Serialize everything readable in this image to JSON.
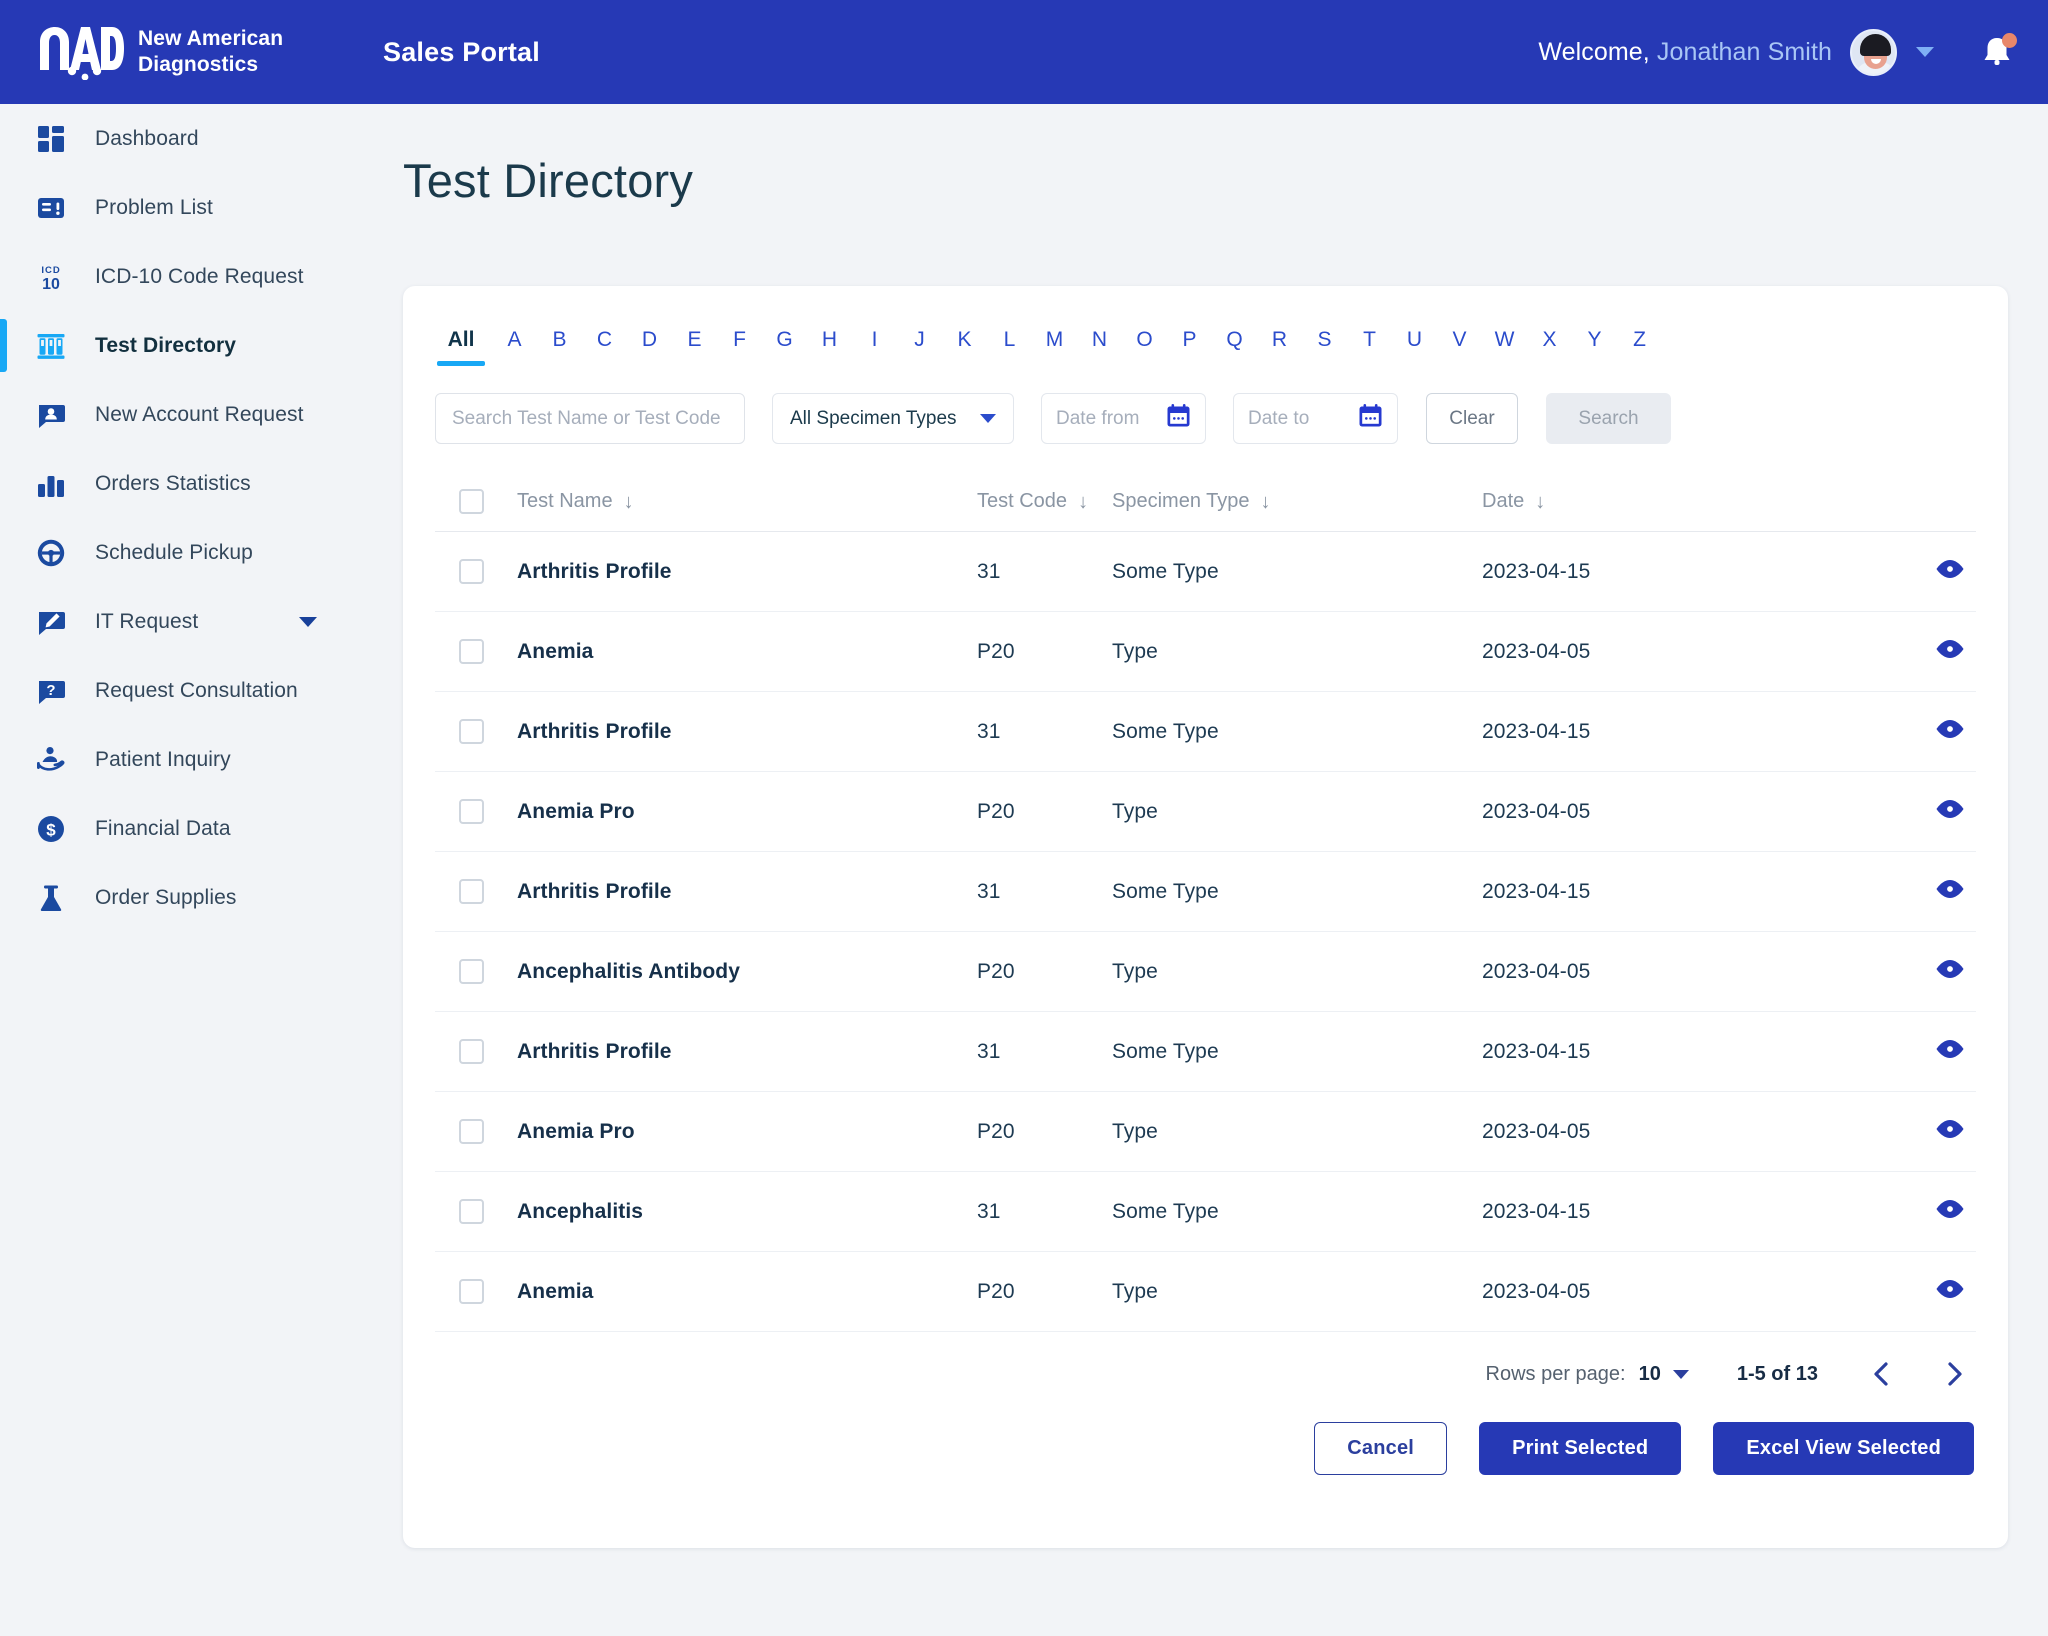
{
  "brand": {
    "logo_icon": "nad-logo-icon",
    "name_line1": "New American",
    "name_line2": "Diagnostics",
    "portal_title": "Sales Portal"
  },
  "header": {
    "welcome_prefix": "Welcome,",
    "user_name": "Jonathan Smith",
    "avatar_icon": "user-avatar",
    "chevron_icon": "chevron-down-icon",
    "bell_icon": "notification-bell-icon",
    "bar_color": "#2639b5",
    "name_color": "#a9c6f5",
    "badge_color": "#e8876a"
  },
  "sidebar": {
    "active_item": "Test Directory",
    "accent_color": "#18a8f5",
    "icon_color": "#1b4aa0",
    "items": [
      {
        "label": "Dashboard",
        "icon": "dashboard-grid-icon",
        "active": false,
        "expandable": false
      },
      {
        "label": "Problem List",
        "icon": "problem-list-icon",
        "active": false,
        "expandable": false
      },
      {
        "label": "ICD-10 Code Request",
        "icon": "icd-10-icon",
        "active": false,
        "expandable": false
      },
      {
        "label": "Test Directory",
        "icon": "test-tube-rack-icon",
        "active": true,
        "expandable": false
      },
      {
        "label": "New Account Request",
        "icon": "account-request-icon",
        "active": false,
        "expandable": false
      },
      {
        "label": "Orders Statistics",
        "icon": "bar-chart-icon",
        "active": false,
        "expandable": false
      },
      {
        "label": "Schedule Pickup",
        "icon": "steering-wheel-icon",
        "active": false,
        "expandable": false
      },
      {
        "label": "IT Request",
        "icon": "it-request-icon",
        "active": false,
        "expandable": true
      },
      {
        "label": "Request Consultation",
        "icon": "question-bubble-icon",
        "active": false,
        "expandable": false
      },
      {
        "label": "Patient Inquiry",
        "icon": "patient-inquiry-icon",
        "active": false,
        "expandable": false
      },
      {
        "label": "Financial Data",
        "icon": "dollar-circle-icon",
        "active": false,
        "expandable": false
      },
      {
        "label": "Order Supplies",
        "icon": "flask-icon",
        "active": false,
        "expandable": false
      }
    ]
  },
  "page": {
    "title": "Test Directory"
  },
  "alpha_filter": {
    "selected": "All",
    "items": [
      "All",
      "A",
      "B",
      "C",
      "D",
      "E",
      "F",
      "G",
      "H",
      "I",
      "J",
      "K",
      "L",
      "M",
      "N",
      "O",
      "P",
      "Q",
      "R",
      "S",
      "T",
      "U",
      "V",
      "W",
      "X",
      "Y",
      "Z"
    ]
  },
  "filters": {
    "search": {
      "value": "",
      "placeholder": "Search Test Name or Test Code"
    },
    "specimen_type": {
      "selected": "All Specimen Types",
      "caret_icon": "chevron-down-icon"
    },
    "date_from": {
      "value": "",
      "placeholder": "Date from",
      "icon": "calendar-icon"
    },
    "date_to": {
      "value": "",
      "placeholder": "Date to",
      "icon": "calendar-icon"
    },
    "clear_label": "Clear",
    "search_label": "Search",
    "search_disabled": true
  },
  "table": {
    "select_all_checked": false,
    "sort_icon": "sort-down-arrow",
    "row_action_icon": "eye-icon",
    "columns": [
      {
        "key": "name",
        "label": "Test Name",
        "sortable": true
      },
      {
        "key": "code",
        "label": "Test Code",
        "sortable": true
      },
      {
        "key": "spec",
        "label": "Specimen Type",
        "sortable": true
      },
      {
        "key": "date",
        "label": "Date",
        "sortable": true
      }
    ],
    "rows": [
      {
        "checked": false,
        "name": "Arthritis Profile",
        "code": "31",
        "spec": "Some Type",
        "date": "2023-04-15"
      },
      {
        "checked": false,
        "name": "Anemia",
        "code": "P20",
        "spec": "Type",
        "date": "2023-04-05"
      },
      {
        "checked": false,
        "name": "Arthritis Profile",
        "code": "31",
        "spec": "Some Type",
        "date": "2023-04-15"
      },
      {
        "checked": false,
        "name": "Anemia Pro",
        "code": "P20",
        "spec": "Type",
        "date": "2023-04-05"
      },
      {
        "checked": false,
        "name": "Arthritis Profile",
        "code": "31",
        "spec": "Some Type",
        "date": "2023-04-15"
      },
      {
        "checked": false,
        "name": "Ancephalitis Antibody",
        "code": "P20",
        "spec": "Type",
        "date": "2023-04-05"
      },
      {
        "checked": false,
        "name": "Arthritis Profile",
        "code": "31",
        "spec": "Some Type",
        "date": "2023-04-15"
      },
      {
        "checked": false,
        "name": "Anemia Pro",
        "code": "P20",
        "spec": "Type",
        "date": "2023-04-05"
      },
      {
        "checked": false,
        "name": "Ancephalitis",
        "code": "31",
        "spec": "Some Type",
        "date": "2023-04-15"
      },
      {
        "checked": false,
        "name": "Anemia",
        "code": "P20",
        "spec": "Type",
        "date": "2023-04-05"
      }
    ]
  },
  "pagination": {
    "rows_per_page_label": "Rows per page:",
    "rows_per_page_value": "10",
    "caret_icon": "chevron-down-icon",
    "range_text": "1-5 of 13",
    "prev_icon": "chevron-left-icon",
    "next_icon": "chevron-right-icon"
  },
  "footer": {
    "cancel_label": "Cancel",
    "print_label": "Print Selected",
    "excel_label": "Excel View Selected",
    "primary_color": "#2639b5"
  }
}
